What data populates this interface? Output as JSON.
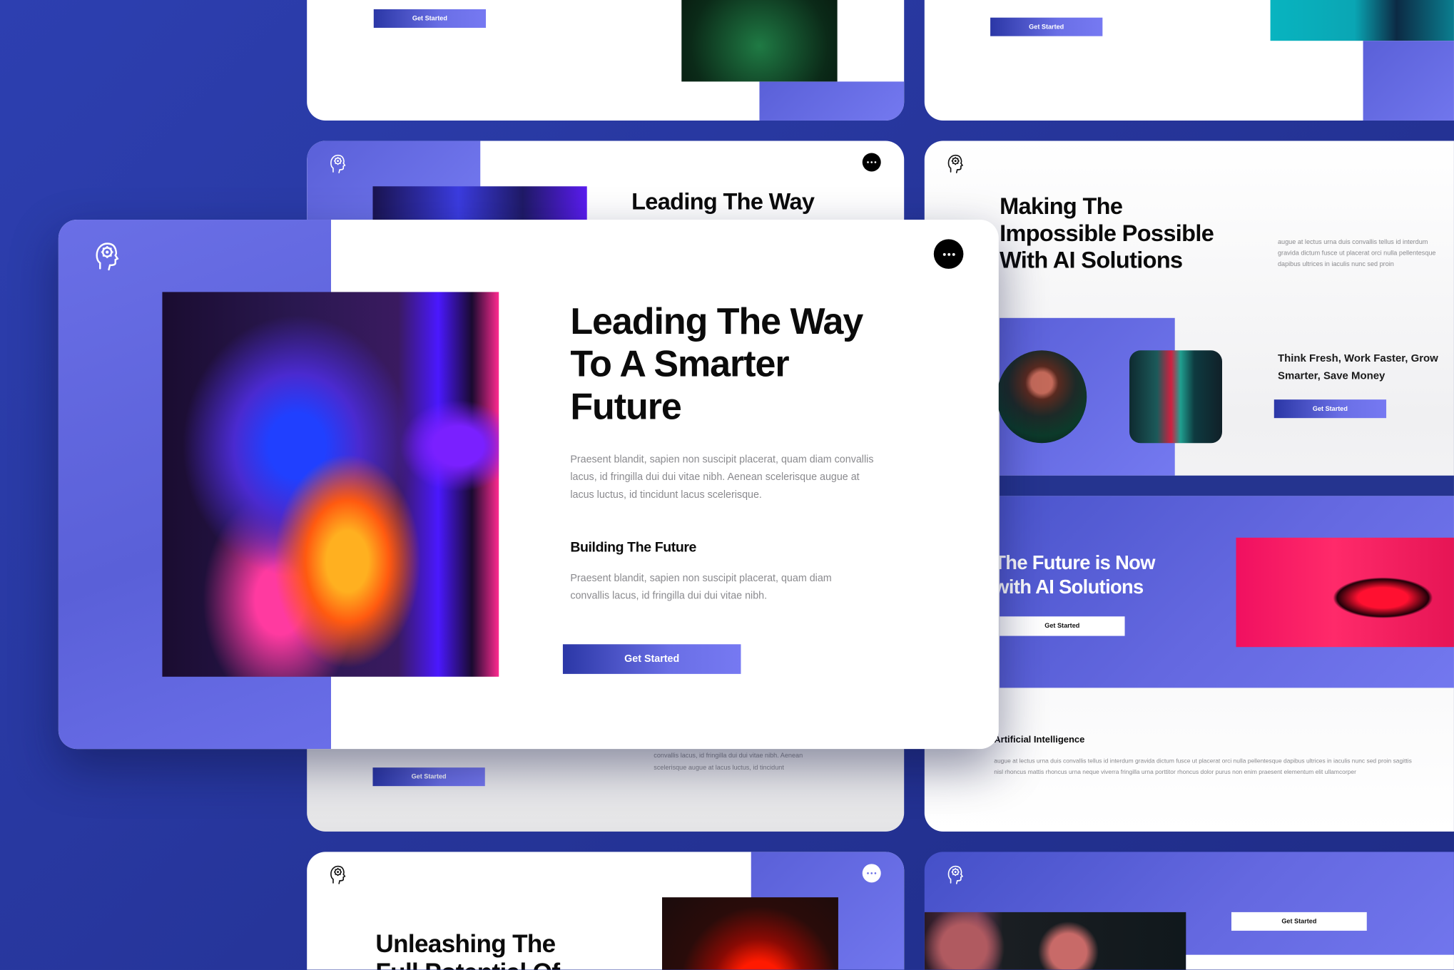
{
  "colors": {
    "background": "#2a399f",
    "accent": "#6a6fe6",
    "accent_dark": "#2b37a6",
    "text": "#0b0b0b",
    "muted": "#8a8a8e"
  },
  "icons": {
    "logo": "brain-gear-head-icon",
    "menu": "more-dots-icon"
  },
  "top_left_slide": {
    "button": "Get Started"
  },
  "top_right_slide": {
    "button": "Get Started"
  },
  "middle_left_slide": {
    "title": "Leading The Way",
    "button": "Get Started",
    "text_lines": [
      "convallis lacus, id fringilla dui dui vitae nibh. Aenean",
      "scelerisque augue at lacus luctus, id tincidunt"
    ]
  },
  "middle_right_slide": {
    "title_lines": [
      "Making The",
      "Impossible Possible",
      "With AI Solutions"
    ],
    "text_lines": [
      "augue at lectus urna duis convallis tellus id interdum",
      "gravida dictum fusce ut placerat orci nulla pellentesque",
      "dapibus ultrices in iaculis nunc sed proin"
    ],
    "tagline_lines": [
      "Think Fresh, Work Faster, Grow",
      "Smarter, Save Money"
    ],
    "button": "Get Started",
    "banner_title_lines": [
      "The Future is Now",
      "with AI Solutions"
    ],
    "banner_button": "Get Started",
    "section_title": "Artificial Intelligence",
    "section_text_lines": [
      "augue at lectus urna duis convallis tellus id interdum gravida dictum fusce ut placerat orci nulla pellentesque dapibus ultrices in iaculis nunc sed proin sagittis",
      "nisl rhoncus mattis rhoncus urna neque viverra fringilla urna porttitor rhoncus dolor purus non enim praesent elementum elit ullamcorper"
    ]
  },
  "main_slide": {
    "title_lines": [
      "Leading The Way",
      "To A Smarter",
      "Future"
    ],
    "paragraph_lines": [
      "Praesent blandit, sapien non suscipit placerat, quam diam convallis",
      "lacus, id fringilla dui dui vitae nibh. Aenean scelerisque augue at",
      "lacus luctus, id tincidunt lacus scelerisque."
    ],
    "subtitle": "Building The Future",
    "paragraph2_lines": [
      "Praesent blandit, sapien non suscipit placerat, quam diam",
      "convallis lacus, id fringilla dui dui vitae nibh."
    ],
    "button": "Get Started"
  },
  "bottom_left_slide": {
    "title_lines": [
      "Unleashing The",
      "Full Potential Of"
    ]
  },
  "bottom_right_slide": {
    "button": "Get Started"
  }
}
